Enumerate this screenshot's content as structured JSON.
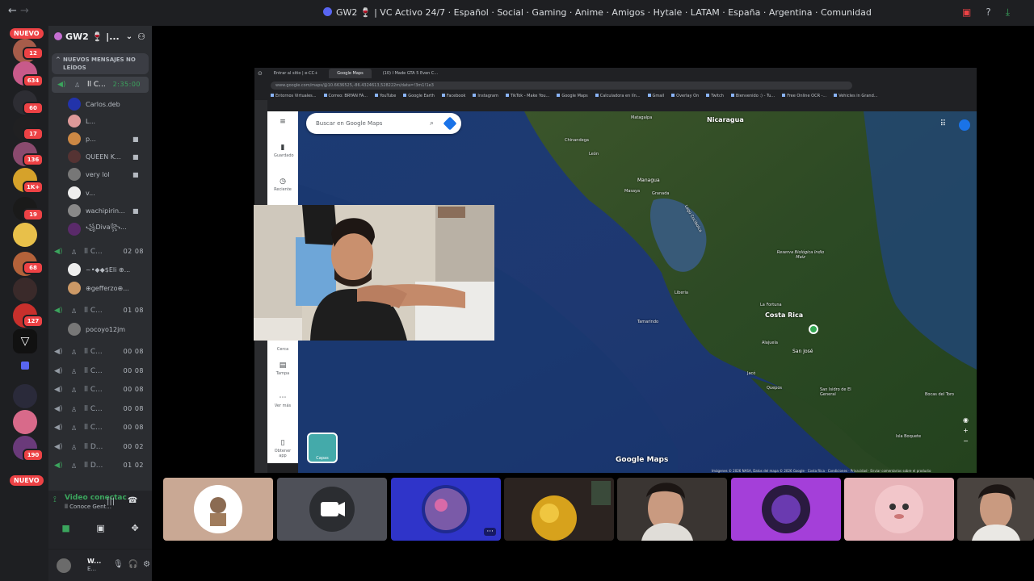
{
  "titlebar": {
    "title": "GW2 🍷 | VC Activo 24/7 · Español · Social · Gaming · Anime · Amigos · Hytale · LATAM · España · Argentina · Comunidad",
    "nav_back": "←",
    "nav_forward": "→"
  },
  "guild_rail": {
    "nuevo_top": "NUEVO",
    "nuevo_bottom": "NUEVO",
    "badges": [
      "12",
      "634",
      "60",
      "17",
      "136",
      "1K+",
      "19",
      "68",
      "127",
      "190"
    ]
  },
  "server": {
    "name": "GW2 🍷 |...",
    "new_messages": "NUEVOS MENSAJES NO LEÍDOS"
  },
  "voice_channels": [
    {
      "name": "ll C...",
      "time": "2:35:00",
      "active": true
    },
    {
      "name": "ll C...",
      "time": "02 08"
    },
    {
      "name": "ll C...",
      "time": "01 08"
    },
    {
      "name": "ll C...",
      "time": "00 08"
    },
    {
      "name": "ll C...",
      "time": "00 08"
    },
    {
      "name": "ll C...",
      "time": "00 08"
    },
    {
      "name": "ll C...",
      "time": "00 08"
    },
    {
      "name": "ll C...",
      "time": "00 08"
    },
    {
      "name": "ll D...",
      "time": "00 02"
    },
    {
      "name": "ll D...",
      "time": "01 02"
    }
  ],
  "members": [
    {
      "name": "Carlos.deb"
    },
    {
      "name": "L..."
    },
    {
      "name": "p..."
    },
    {
      "name": "QUЕЕN K..."
    },
    {
      "name": "very lol"
    },
    {
      "name": "v..."
    },
    {
      "name": "wachipirin..."
    },
    {
      "name": "꧁Diva꧂..."
    },
    {
      "name": "~•◆◆$Eli ⊕..."
    },
    {
      "name": "⊕gefferzo⊕..."
    },
    {
      "name": "pocoyo12jm"
    }
  ],
  "voice_panel": {
    "status": "Video conectac",
    "sub": "ll Conoce Gent..."
  },
  "user_panel": {
    "name": "W...",
    "status": "E..."
  },
  "browser": {
    "tabs": [
      "Entrar al sitio | e-CC+",
      "Google Maps",
      "(10) I Made GTA 5 Even C..."
    ],
    "url": "www.google.com/maps/@10.6636525,-86.4324613,528222m/data=!3m1!1e3",
    "bookmarks": [
      "Entornos Virtuales...",
      "Correo: BRYAN FA...",
      "YouTube",
      "Google Earth",
      "Facebook",
      "Instagram",
      "TikTok - Make You...",
      "Google Maps",
      "Calculadora en lín...",
      "Gmail",
      "Overlay On",
      "Twitch",
      "Bienvenido :) - Tu...",
      "Free Online OCR -...",
      "Vehicles in Grand..."
    ]
  },
  "maps": {
    "search_placeholder": "Buscar en Google Maps",
    "rail": [
      "Guardado",
      "Reciente",
      "Cerca",
      "Tampa",
      "Ver más",
      "Obtener app"
    ],
    "layers": "Capas",
    "watermark": "Google Maps",
    "attribution": "Imágenes © 2026 NASA, Datos del mapa © 2026 Google · Costa Rica · Condiciones · Privacidad · Enviar comentarios sobre el producto",
    "places": [
      {
        "name": "Nicaragua",
        "size": "big"
      },
      {
        "name": "Matagalpa",
        "size": "sm"
      },
      {
        "name": "Chinandega",
        "size": "sm"
      },
      {
        "name": "León",
        "size": "sm"
      },
      {
        "name": "Managua",
        "size": "normal"
      },
      {
        "name": "Masaya",
        "size": "sm"
      },
      {
        "name": "Granada",
        "size": "sm"
      },
      {
        "name": "Lago Cocibolca",
        "size": "sm"
      },
      {
        "name": "Reserva Biológica Indio Maíz",
        "size": "sm"
      },
      {
        "name": "Liberia",
        "size": "sm"
      },
      {
        "name": "La Fortuna",
        "size": "sm"
      },
      {
        "name": "Costa Rica",
        "size": "big"
      },
      {
        "name": "Tamarindo",
        "size": "sm"
      },
      {
        "name": "Alajuela",
        "size": "sm"
      },
      {
        "name": "San José",
        "size": "normal"
      },
      {
        "name": "Jacó",
        "size": "sm"
      },
      {
        "name": "Quepos",
        "size": "sm"
      },
      {
        "name": "San Isidro de El General",
        "size": "sm"
      },
      {
        "name": "Bocas del Toro",
        "size": "sm"
      },
      {
        "name": "Isla Boquete",
        "size": "sm"
      }
    ]
  },
  "tiles": [
    {
      "kind": "avatar",
      "color": "#c9a894"
    },
    {
      "kind": "camera-off",
      "color": "#4e5058"
    },
    {
      "kind": "avatar",
      "color": "#2f34c9",
      "more": "···"
    },
    {
      "kind": "video",
      "color": "#2b2320"
    },
    {
      "kind": "video",
      "color": "#3a3532"
    },
    {
      "kind": "avatar",
      "color": "#a43fd9"
    },
    {
      "kind": "avatar",
      "color": "#e8b4b9"
    },
    {
      "kind": "video",
      "color": "#4a4440"
    }
  ]
}
